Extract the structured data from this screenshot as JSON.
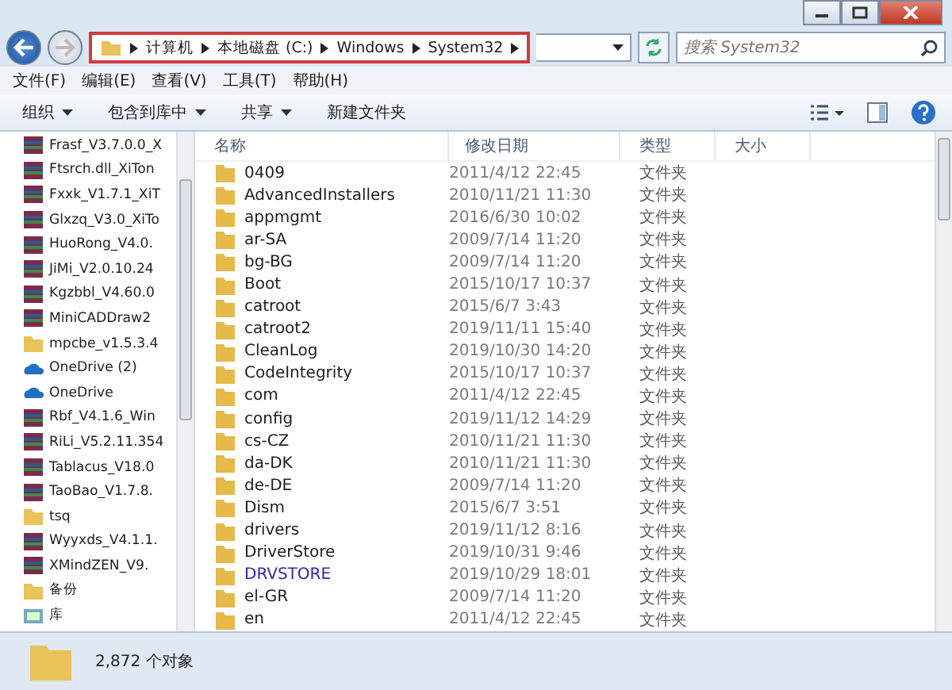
{
  "address_bar": {
    "highlighted": true,
    "crumbs": [
      "计算机",
      "本地磁盘 (C:)",
      "Windows",
      "System32"
    ]
  },
  "search": {
    "placeholder": "搜索 System32"
  },
  "menu": [
    "文件(F)",
    "编辑(E)",
    "查看(V)",
    "工具(T)",
    "帮助(H)"
  ],
  "toolbar": [
    {
      "label": "组织",
      "dropdown": true
    },
    {
      "label": "包含到库中",
      "dropdown": true
    },
    {
      "label": "共享",
      "dropdown": true
    },
    {
      "label": "新建文件夹",
      "dropdown": false
    }
  ],
  "sidebar": {
    "items": [
      {
        "label": "Frasf_V3.7.0.0_X",
        "kind": "archive"
      },
      {
        "label": "Ftsrch.dll_XiTon",
        "kind": "archive"
      },
      {
        "label": "Fxxk_V1.7.1_XiT",
        "kind": "archive"
      },
      {
        "label": "Glxzq_V3.0_XiTo",
        "kind": "archive"
      },
      {
        "label": "HuoRong_V4.0.",
        "kind": "archive"
      },
      {
        "label": "JiMi_V2.0.10.24",
        "kind": "archive"
      },
      {
        "label": "Kgzbbl_V4.60.0",
        "kind": "archive"
      },
      {
        "label": "MiniCADDraw2",
        "kind": "archive"
      },
      {
        "label": "mpcbe_v1.5.3.4",
        "kind": "folder"
      },
      {
        "label": "OneDrive (2)",
        "kind": "cloud"
      },
      {
        "label": "OneDrive",
        "kind": "cloud"
      },
      {
        "label": "Rbf_V4.1.6_Win",
        "kind": "archive"
      },
      {
        "label": "RiLi_V5.2.11.354",
        "kind": "archive"
      },
      {
        "label": "Tablacus_V18.0",
        "kind": "archive"
      },
      {
        "label": "TaoBao_V1.7.8.",
        "kind": "archive"
      },
      {
        "label": "tsq",
        "kind": "folder"
      },
      {
        "label": "Wyyxds_V4.1.1.",
        "kind": "archive"
      },
      {
        "label": "XMindZEN_V9.",
        "kind": "archive"
      },
      {
        "label": "备份",
        "kind": "folder"
      },
      {
        "label": "库",
        "kind": "library"
      }
    ]
  },
  "table": {
    "columns": [
      "名称",
      "修改日期",
      "类型",
      "大小"
    ],
    "rows": [
      {
        "name": "0409",
        "date": "2011/4/12 22:45",
        "type": "文件夹",
        "compressed": false
      },
      {
        "name": "AdvancedInstallers",
        "date": "2010/11/21 11:30",
        "type": "文件夹",
        "compressed": false
      },
      {
        "name": "appmgmt",
        "date": "2016/6/30 10:02",
        "type": "文件夹",
        "compressed": false
      },
      {
        "name": "ar-SA",
        "date": "2009/7/14 11:20",
        "type": "文件夹",
        "compressed": false
      },
      {
        "name": "bg-BG",
        "date": "2009/7/14 11:20",
        "type": "文件夹",
        "compressed": false
      },
      {
        "name": "Boot",
        "date": "2015/10/17 10:37",
        "type": "文件夹",
        "compressed": false
      },
      {
        "name": "catroot",
        "date": "2015/6/7 3:43",
        "type": "文件夹",
        "compressed": false
      },
      {
        "name": "catroot2",
        "date": "2019/11/11 15:40",
        "type": "文件夹",
        "compressed": false
      },
      {
        "name": "CleanLog",
        "date": "2019/10/30 14:20",
        "type": "文件夹",
        "compressed": false
      },
      {
        "name": "CodeIntegrity",
        "date": "2015/10/17 10:37",
        "type": "文件夹",
        "compressed": false
      },
      {
        "name": "com",
        "date": "2011/4/12 22:45",
        "type": "文件夹",
        "compressed": false
      },
      {
        "name": "config",
        "date": "2019/11/12 14:29",
        "type": "文件夹",
        "compressed": false
      },
      {
        "name": "cs-CZ",
        "date": "2010/11/21 11:30",
        "type": "文件夹",
        "compressed": false
      },
      {
        "name": "da-DK",
        "date": "2010/11/21 11:30",
        "type": "文件夹",
        "compressed": false
      },
      {
        "name": "de-DE",
        "date": "2009/7/14 11:20",
        "type": "文件夹",
        "compressed": false
      },
      {
        "name": "Dism",
        "date": "2015/6/7 3:51",
        "type": "文件夹",
        "compressed": false
      },
      {
        "name": "drivers",
        "date": "2019/11/12 8:16",
        "type": "文件夹",
        "compressed": false
      },
      {
        "name": "DriverStore",
        "date": "2019/10/31 9:46",
        "type": "文件夹",
        "compressed": false
      },
      {
        "name": "DRVSTORE",
        "date": "2019/10/29 18:01",
        "type": "文件夹",
        "compressed": true
      },
      {
        "name": "el-GR",
        "date": "2009/7/14 11:20",
        "type": "文件夹",
        "compressed": false
      },
      {
        "name": "en",
        "date": "2011/4/12 22:45",
        "type": "文件夹",
        "compressed": false
      }
    ]
  },
  "status_bar": {
    "count": "2,872 个对象"
  }
}
